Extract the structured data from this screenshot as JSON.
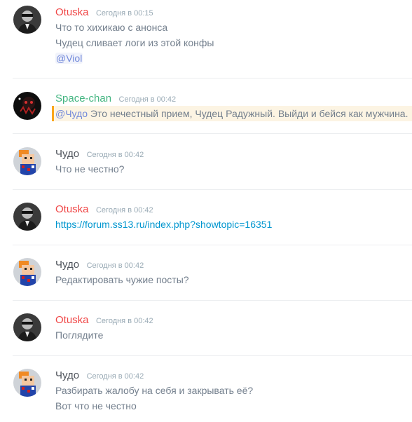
{
  "colors": {
    "otuska": "#f04747",
    "space_chan": "#43b581",
    "chudo": "#4f545c",
    "mention": "#7289da",
    "link": "#0096cf",
    "highlight_bar": "#faa61a",
    "highlight_bg": "#fcf4e3"
  },
  "messages": [
    {
      "author": "Otuska",
      "timestamp": "Сегодня в 00:15",
      "avatar_icon": "otuska-avatar-icon",
      "lines": [
        "Что то хихикаю с анонса",
        "Чудец сливает логи из этой конфы"
      ],
      "mention": "@Viol"
    },
    {
      "author": "Space-chan",
      "timestamp": "Сегодня в 00:42",
      "avatar_icon": "space-chan-avatar-icon",
      "mention": "@Чудо",
      "text": " Это нечестный прием, Чудец Радужный. Выйди и бейся как мужчина."
    },
    {
      "author": "Чудо",
      "timestamp": "Сегодня в 00:42",
      "avatar_icon": "chudo-avatar-icon",
      "lines": [
        "Что не честно?"
      ]
    },
    {
      "author": "Otuska",
      "timestamp": "Сегодня в 00:42",
      "avatar_icon": "otuska-avatar-icon",
      "link": "https://forum.ss13.ru/index.php?showtopic=16351"
    },
    {
      "author": "Чудо",
      "timestamp": "Сегодня в 00:42",
      "avatar_icon": "chudo-avatar-icon",
      "lines": [
        "Редактировать чужие посты?"
      ]
    },
    {
      "author": "Otuska",
      "timestamp": "Сегодня в 00:42",
      "avatar_icon": "otuska-avatar-icon",
      "lines": [
        "Поглядите"
      ]
    },
    {
      "author": "Чудо",
      "timestamp": "Сегодня в 00:42",
      "avatar_icon": "chudo-avatar-icon",
      "lines": [
        "Разбирать жалобу на себя и закрывать её?",
        "Вот что не честно"
      ]
    }
  ]
}
